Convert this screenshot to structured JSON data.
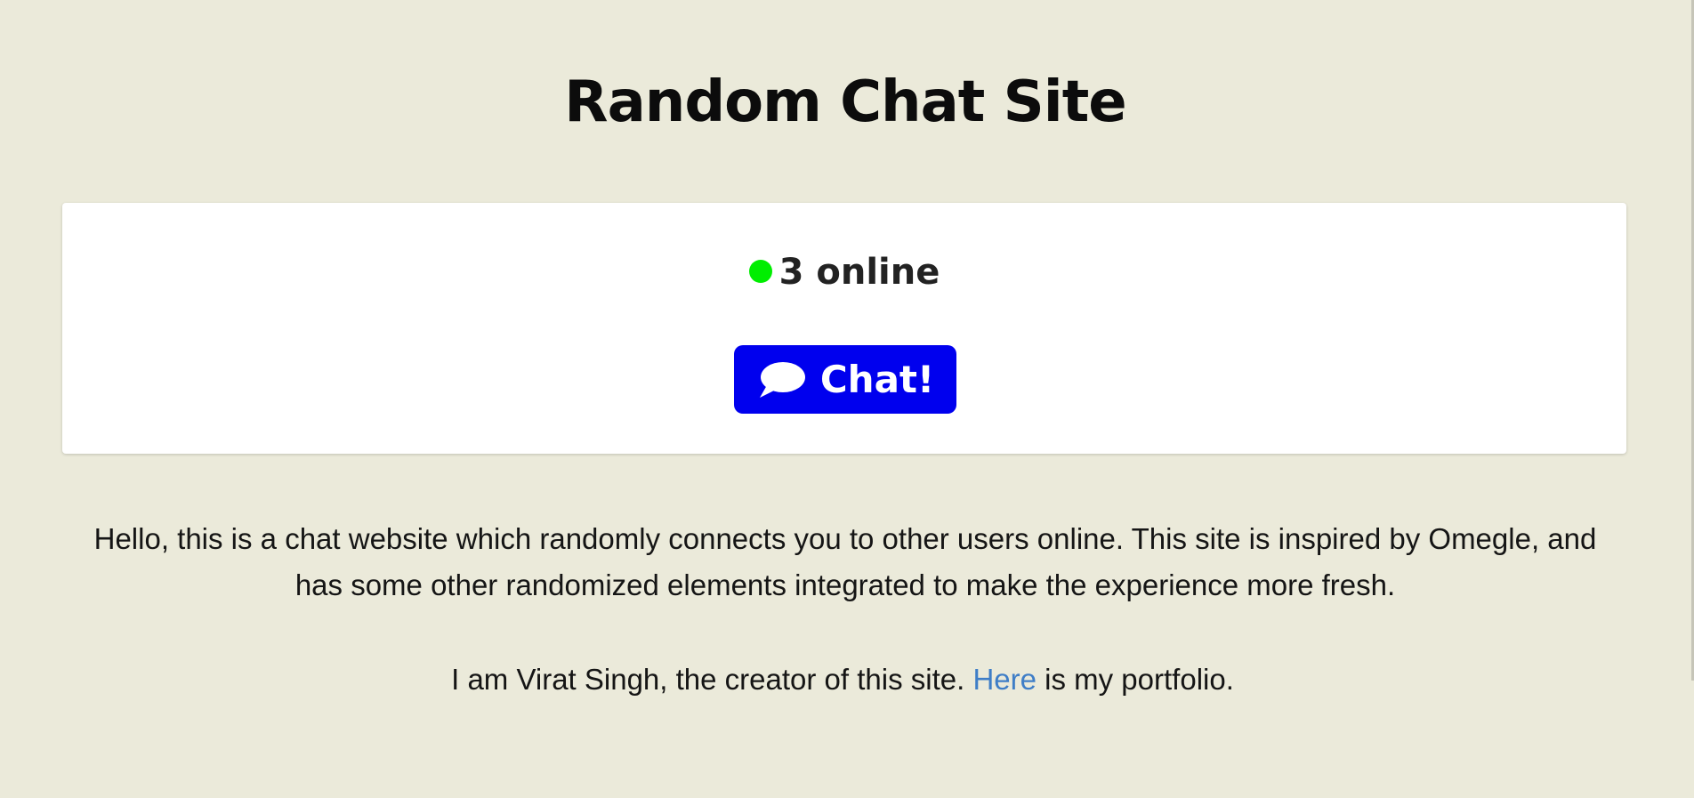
{
  "header": {
    "title": "Random Chat Site"
  },
  "status": {
    "online_text": "3 online",
    "indicator_color": "#00ee00"
  },
  "chat_button": {
    "label": "Chat!",
    "icon": "speech-bubble-icon",
    "color": "#0000ee"
  },
  "intro": {
    "text": "Hello, this is a chat website which randomly connects you to other users online. This site is inspired by Omegle, and has some other randomized elements integrated to make the experience more fresh."
  },
  "creator": {
    "before_link": "I am Virat Singh, the creator of this site. ",
    "link_text": "Here",
    "after_link": " is my portfolio.",
    "link_color": "#3f7ec7"
  },
  "colors": {
    "background": "#ebeada",
    "card": "#ffffff"
  }
}
